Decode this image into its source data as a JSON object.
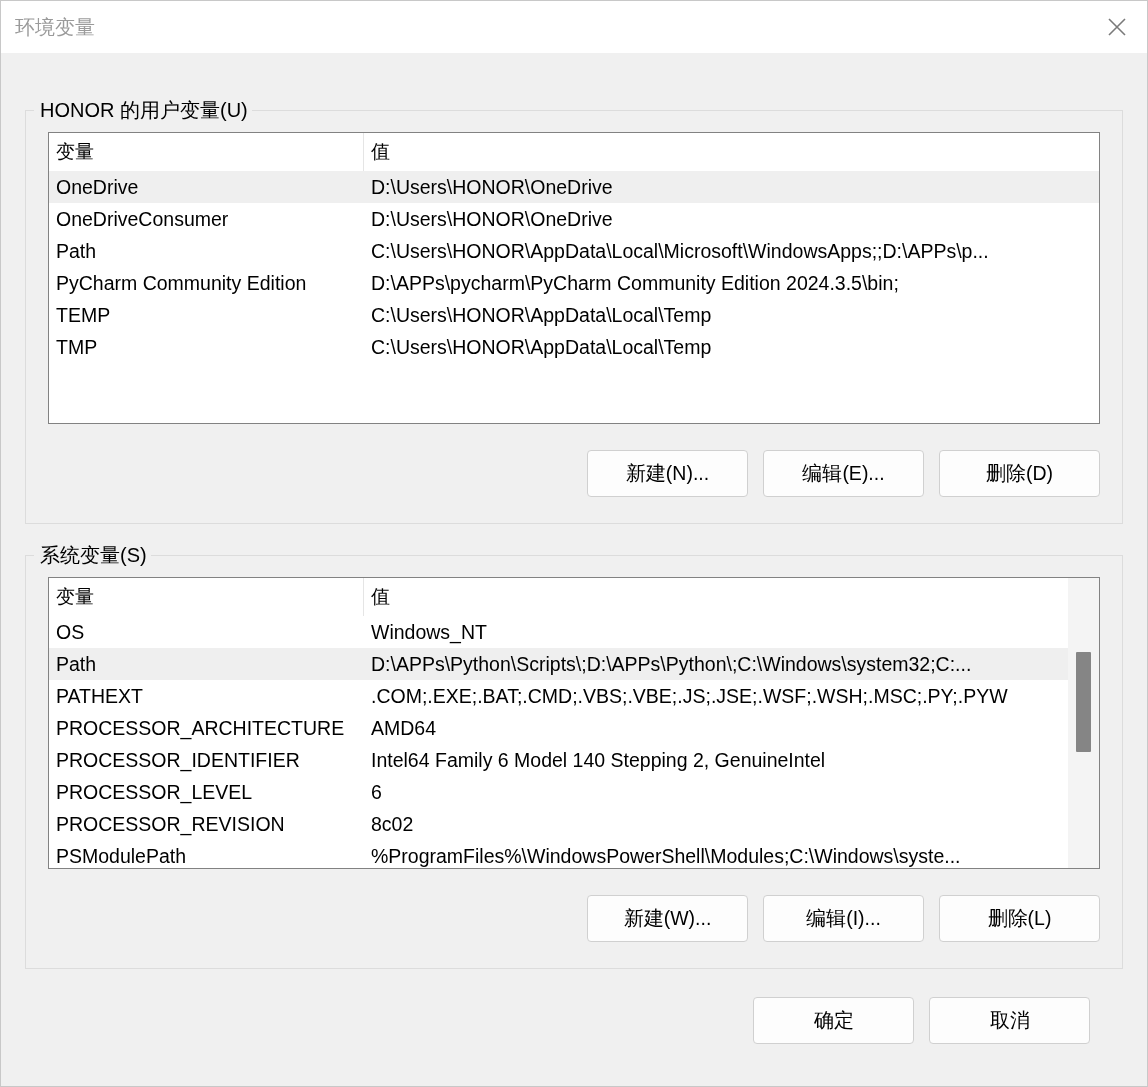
{
  "window": {
    "title": "环境变量"
  },
  "groups": [
    {
      "title": "HONOR 的用户变量(U)",
      "columns": [
        "变量",
        "值"
      ],
      "scrollbar": false,
      "rows": [
        {
          "name": "OneDrive",
          "value": "D:\\Users\\HONOR\\OneDrive",
          "selected": true
        },
        {
          "name": "OneDriveConsumer",
          "value": "D:\\Users\\HONOR\\OneDrive",
          "selected": false
        },
        {
          "name": "Path",
          "value": "C:\\Users\\HONOR\\AppData\\Local\\Microsoft\\WindowsApps;;D:\\APPs\\p...",
          "selected": false
        },
        {
          "name": "PyCharm Community Edition",
          "value": "D:\\APPs\\pycharm\\PyCharm Community Edition 2024.3.5\\bin;",
          "selected": false
        },
        {
          "name": "TEMP",
          "value": "C:\\Users\\HONOR\\AppData\\Local\\Temp",
          "selected": false
        },
        {
          "name": "TMP",
          "value": "C:\\Users\\HONOR\\AppData\\Local\\Temp",
          "selected": false
        }
      ],
      "buttons": [
        "新建(N)...",
        "编辑(E)...",
        "删除(D)"
      ]
    },
    {
      "title": "系统变量(S)",
      "columns": [
        "变量",
        "值"
      ],
      "scrollbar": true,
      "rows": [
        {
          "name": "OS",
          "value": "Windows_NT",
          "selected": false
        },
        {
          "name": "Path",
          "value": "D:\\APPs\\Python\\Scripts\\;D:\\APPs\\Python\\;C:\\Windows\\system32;C:...",
          "selected": true
        },
        {
          "name": "PATHEXT",
          "value": ".COM;.EXE;.BAT;.CMD;.VBS;.VBE;.JS;.JSE;.WSF;.WSH;.MSC;.PY;.PYW",
          "selected": false
        },
        {
          "name": "PROCESSOR_ARCHITECTURE",
          "value": "AMD64",
          "selected": false
        },
        {
          "name": "PROCESSOR_IDENTIFIER",
          "value": "Intel64 Family 6 Model 140 Stepping 2, GenuineIntel",
          "selected": false
        },
        {
          "name": "PROCESSOR_LEVEL",
          "value": "6",
          "selected": false
        },
        {
          "name": "PROCESSOR_REVISION",
          "value": "8c02",
          "selected": false
        },
        {
          "name": "PSModulePath",
          "value": "%ProgramFiles%\\WindowsPowerShell\\Modules;C:\\Windows\\syste...",
          "selected": false
        }
      ],
      "buttons": [
        "新建(W)...",
        "编辑(I)...",
        "删除(L)"
      ]
    }
  ],
  "footer_buttons": [
    "确定",
    "取消"
  ]
}
